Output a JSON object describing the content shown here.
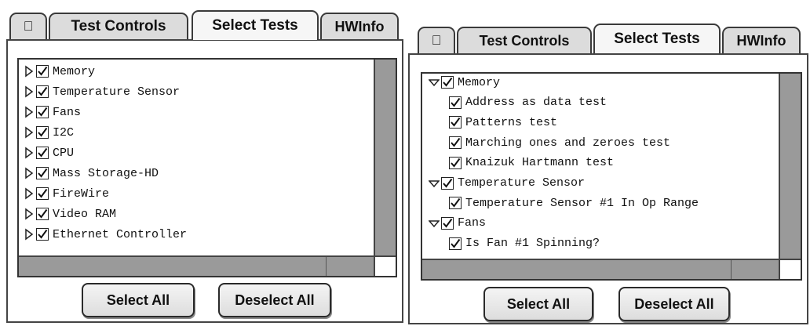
{
  "left_panel": {
    "tabs": [
      {
        "label": "",
        "icon": "apple-icon"
      },
      {
        "label": "Test Controls"
      },
      {
        "label": "Select Tests",
        "active": true
      },
      {
        "label": "HWInfo"
      }
    ],
    "items": [
      {
        "label": "Memory",
        "checked": true,
        "expanded": false
      },
      {
        "label": "Temperature Sensor",
        "checked": true,
        "expanded": false
      },
      {
        "label": "Fans",
        "checked": true,
        "expanded": false
      },
      {
        "label": "I2C",
        "checked": true,
        "expanded": false
      },
      {
        "label": "CPU",
        "checked": true,
        "expanded": false
      },
      {
        "label": "Mass Storage-HD",
        "checked": true,
        "expanded": false
      },
      {
        "label": "FireWire",
        "checked": true,
        "expanded": false
      },
      {
        "label": "Video RAM",
        "checked": true,
        "expanded": false
      },
      {
        "label": "Ethernet Controller",
        "checked": true,
        "expanded": false
      }
    ],
    "buttons": {
      "select_all": "Select All",
      "deselect_all": "Deselect All"
    }
  },
  "right_panel": {
    "tabs": [
      {
        "label": "",
        "icon": "apple-icon"
      },
      {
        "label": "Test Controls"
      },
      {
        "label": "Select Tests",
        "active": true
      },
      {
        "label": "HWInfo"
      }
    ],
    "items": [
      {
        "label": "Memory",
        "checked": true,
        "expanded": true,
        "level": 0
      },
      {
        "label": "Address as data test",
        "checked": true,
        "level": 1
      },
      {
        "label": "Patterns test",
        "checked": true,
        "level": 1
      },
      {
        "label": "Marching ones and zeroes test",
        "checked": true,
        "level": 1
      },
      {
        "label": "Knaizuk Hartmann test",
        "checked": true,
        "level": 1
      },
      {
        "label": "Temperature Sensor",
        "checked": true,
        "expanded": true,
        "level": 0
      },
      {
        "label": "Temperature Sensor #1 In Op Range",
        "checked": true,
        "level": 1
      },
      {
        "label": "Fans",
        "checked": true,
        "expanded": true,
        "level": 0
      },
      {
        "label": "Is Fan #1 Spinning?",
        "checked": true,
        "level": 1
      }
    ],
    "buttons": {
      "select_all": "Select All",
      "deselect_all": "Deselect All"
    }
  },
  "colors": {
    "scrollbar": "#9a9a9a",
    "tab_active": "#f6f6f6",
    "tab_inactive": "#dcdcdc"
  }
}
